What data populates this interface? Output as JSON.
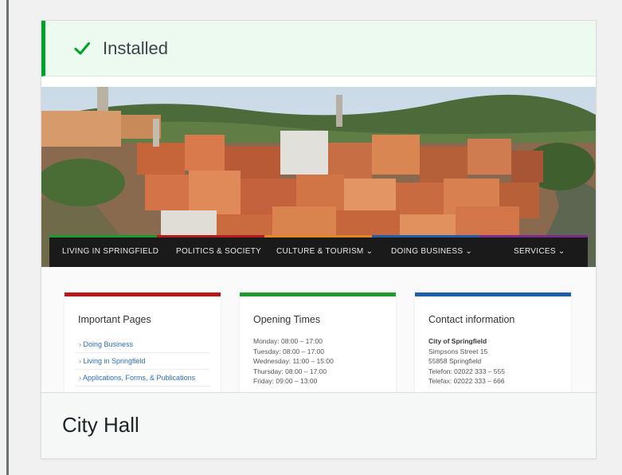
{
  "notice": {
    "text": "Installed",
    "color": "#00a32a"
  },
  "theme_preview": {
    "nav": {
      "items": [
        "LIVING IN SPRINGFIELD",
        "POLITICS & SOCIETY",
        "CULTURE & TOURISM ⌄",
        "DOING BUSINESS ⌄",
        "SERVICES ⌄"
      ],
      "strip_colors": [
        "#1c9a2f",
        "#b01b1b",
        "#e0872a",
        "#1f5fa8",
        "#7a2b8e"
      ]
    },
    "boxes": [
      {
        "title": "Important Pages",
        "bar_color": "#b51a1a",
        "links": [
          "Doing Business",
          "Living in Springfield",
          "Applications, Forms, & Publications"
        ]
      },
      {
        "title": "Opening Times",
        "bar_color": "#1c9a2f",
        "lines": [
          "Monday: 08:00 – 17:00",
          "Tuesday: 08:00 – 17:00",
          "Wednesday: 11:00 – 15:00",
          "Thursday: 08:00 – 17:00",
          "Friday: 09:00 – 13:00"
        ]
      },
      {
        "title": "Contact information",
        "bar_color": "#1f5fa8",
        "org": "City of Springfield",
        "lines": [
          "Simpsons Street 15",
          "55858 Springfield",
          "Telefon: 02022 333 – 555",
          "Telefax: 02022 333 – 666"
        ]
      }
    ]
  },
  "theme": {
    "name": "City Hall"
  }
}
